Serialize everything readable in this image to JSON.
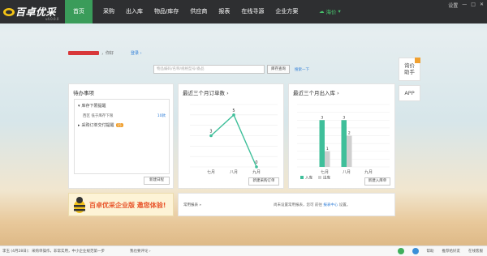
{
  "app": {
    "logo_text": "百卓优采",
    "version": "v4.0.0.0",
    "nav": [
      "首页",
      "采购",
      "出入库",
      "物品/库存",
      "供应商",
      "报表",
      "在线寻源",
      "企业方案"
    ],
    "cloud_user": "海价",
    "window_controls": [
      "设置",
      "—",
      "□",
      "✕"
    ]
  },
  "user": {
    "suffix": "，你好",
    "link": "登录 ›"
  },
  "search": {
    "placeholder": "物品编码/名称/规格型号/备品",
    "button": "库存查询",
    "advanced": "搜索一下"
  },
  "side": {
    "help": "询价助手",
    "app": "APP"
  },
  "todo": {
    "title": "待办事项",
    "stock_alert": "库存下限提醒",
    "sub_label": "西区 低于库存下限",
    "sub_value": "10款",
    "order_alert": "采购订单交付提醒",
    "order_badge": "15",
    "button": "新建日程"
  },
  "orders": {
    "title": "最近三个月订单数 ›",
    "button": "新建采购订单"
  },
  "inbound": {
    "title": "最近三个月出入库 ›",
    "button": "新建入库单",
    "legend_in": "入库",
    "legend_out": "出库"
  },
  "banner": {
    "text": "百卓优采企业版 邀您体验!"
  },
  "common": {
    "label": "常用报表 »",
    "msg_prefix": "尚未设置常用报表，您可 前往 ",
    "msg_link": "报表中心",
    "msg_suffix": " 设置。"
  },
  "status": {
    "tip": "李玉 (4月28日)：采购单操作，非常实用，中小企业规范第一步",
    "middle": "我也要评论 ›",
    "help": "帮助",
    "recommend": "推荐给好友",
    "service": "在线客服"
  },
  "colors": {
    "nav_active": "#3a9c5a",
    "line": "#3fbf9a",
    "in_bar": "#3fbf9a",
    "out_bar": "#cfcfcf"
  },
  "chart_data": [
    {
      "type": "line",
      "categories": [
        "七月",
        "八月",
        "九月"
      ],
      "values": [
        3,
        5,
        0
      ],
      "ylim": [
        0,
        6
      ]
    },
    {
      "type": "bar",
      "categories": [
        "七月",
        "八月",
        "九月"
      ],
      "series": [
        {
          "name": "入库",
          "values": [
            3,
            3,
            0
          ]
        },
        {
          "name": "出库",
          "values": [
            1,
            2,
            0
          ]
        }
      ],
      "ylim": [
        0,
        4
      ]
    }
  ]
}
